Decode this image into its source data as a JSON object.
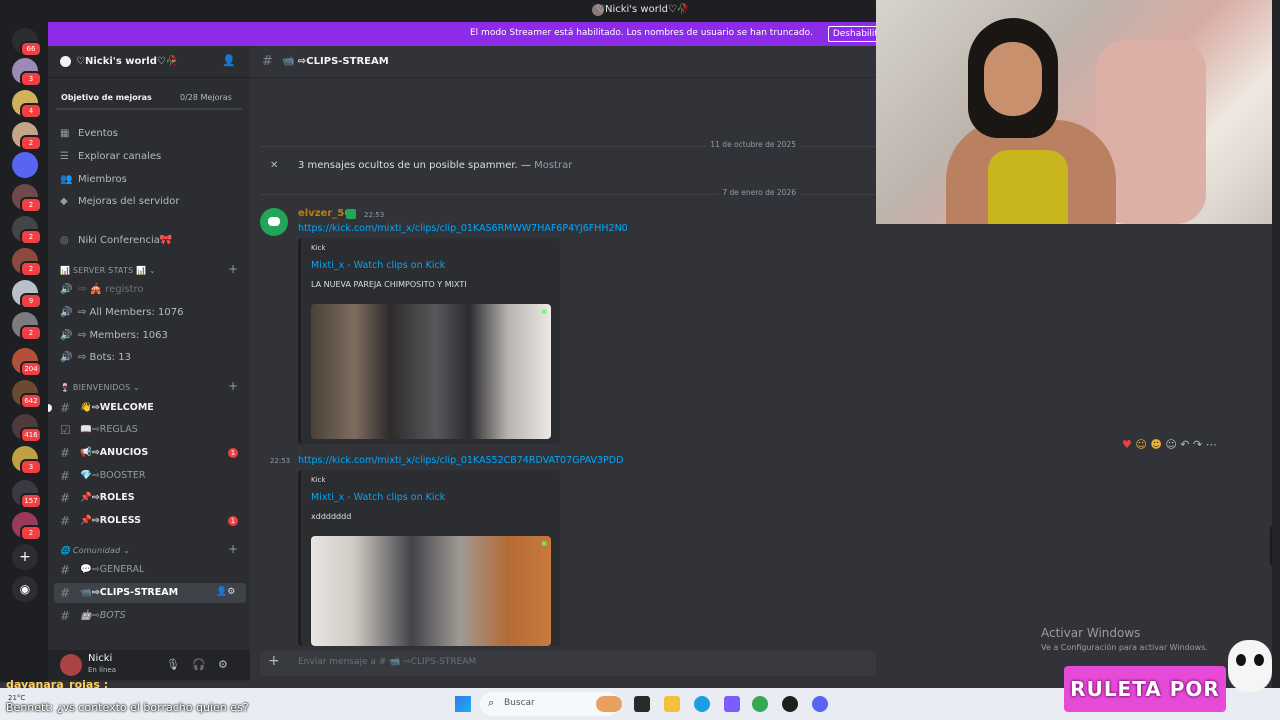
{
  "window": {
    "title": "♡Nicki's world♡🥀"
  },
  "banner": {
    "message": "El modo Streamer está habilitado. Los nombres de usuario se han truncado.",
    "button": "Deshabilitar"
  },
  "rail": {
    "badges": [
      "66",
      "3",
      "4",
      "2",
      "",
      "2",
      "2",
      "2",
      "2",
      "9",
      "2",
      "204",
      "642",
      "416",
      "3",
      "157",
      "2"
    ]
  },
  "server": {
    "name": "♡Nicki's world♡🥀",
    "boost_label": "Objetivo de mejoras",
    "boost_count": "0/28 Mejoras",
    "nav": [
      "Eventos",
      "Explorar canales",
      "Miembros",
      "Mejoras del servidor"
    ],
    "conference": "Niki Conferencia🎀",
    "cat_stats": "📊 SERVER STATS 📊",
    "stats": [
      "⇨ 🎪 registro",
      "⇨ All Members: 1076",
      "⇨ Members: 1063",
      "⇨ Bots: 13"
    ],
    "cat_welcome": "🍷 BIENVENIDOS",
    "welcome_channels": [
      {
        "label": "👋⇨WELCOME",
        "bold": true,
        "badge": ""
      },
      {
        "label": "📖⇨REGLAS",
        "bold": false,
        "badge": ""
      },
      {
        "label": "📢⇨ANUCIOS",
        "bold": true,
        "badge": "1"
      },
      {
        "label": "💎⇨BOOSTER",
        "bold": false,
        "badge": ""
      },
      {
        "label": "📌⇨ROLES",
        "bold": true,
        "badge": ""
      },
      {
        "label": "📌⇨ROLESS",
        "bold": true,
        "badge": "1"
      }
    ],
    "cat_community": "🌐 Comunidad",
    "community_channels": [
      {
        "label": "💬⇨GENERAL"
      },
      {
        "label": "📹⇨CLIPS-STREAM"
      },
      {
        "label": "🤖⇨BOTS"
      }
    ]
  },
  "user": {
    "name": "Nicki",
    "status": "En línea"
  },
  "channel": {
    "name": "📹 ⇨CLIPS-STREAM",
    "composer_placeholder": "Enviar mensaje a # 📹 ⇨CLIPS-STREAM"
  },
  "messages": {
    "date1": "11 de octubre de 2025",
    "hidden": "3 mensajes ocultos de un posible spammer. —",
    "show": "Mostrar",
    "date2": "7 de enero de 2026",
    "author": "elvzer_56",
    "time": "22:53",
    "side_time": "22:53",
    "link1": "https://kick.com/mixti_x/clips/clip_01KAS6RMWW7HAF6P4YJ6FHH2N0",
    "link2": "https://kick.com/mixti_x/clips/clip_01KAS52CB74RDVAT07GPAV3PDD",
    "embeds": [
      {
        "provider": "Kick",
        "title": "Mixti_x - Watch clips on Kick",
        "desc": "LA NUEVA PAREJA CHIMPOSITO Y MIXTI"
      },
      {
        "provider": "Kick",
        "title": "Mixti_x - Watch clips on Kick",
        "desc": "xddddddd"
      }
    ]
  },
  "overlay": {
    "activate_title": "Activar Windows",
    "activate_sub": "Ve a Configuración para activar Windows.",
    "chat_user": "dayanara_rojas :",
    "chat_line": "Bennett: ¿vs contexto el borracho quien es?",
    "ruleta": "RULETA POR SUB"
  },
  "taskbar": {
    "search": "Buscar",
    "weather": "21°C"
  },
  "colors": {
    "accent": "#8c2be8",
    "link": "#00a8fc",
    "online": "#23a559",
    "mention": "#f23f43"
  }
}
